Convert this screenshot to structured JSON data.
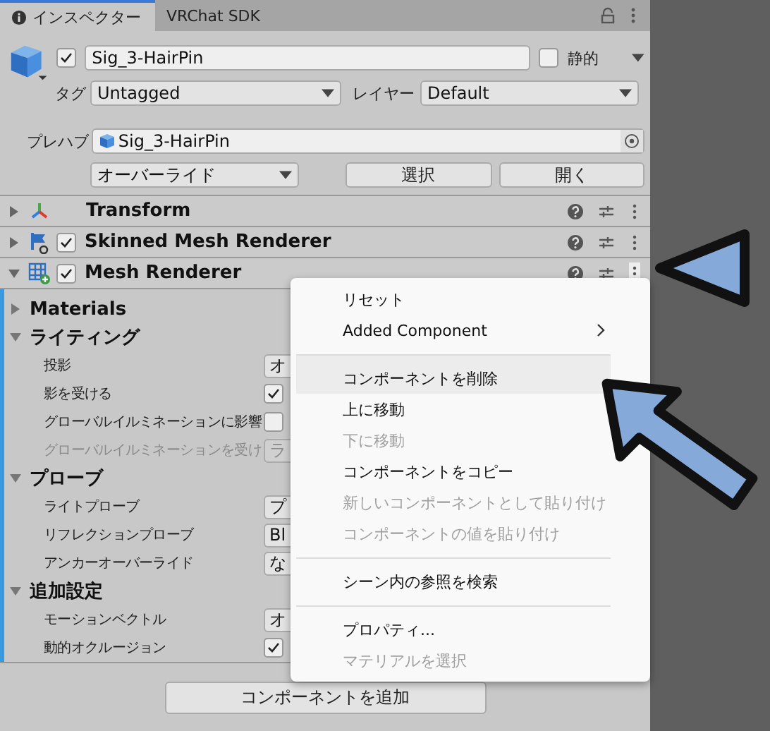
{
  "tabs": [
    {
      "label": "インスペクター",
      "selected": true
    },
    {
      "label": "VRChat SDK",
      "selected": false
    }
  ],
  "object": {
    "enabled": true,
    "name": "Sig_3-HairPin",
    "static": false,
    "static_label": "静的"
  },
  "tag": {
    "label": "タグ",
    "value": "Untagged"
  },
  "layer": {
    "label": "レイヤー",
    "value": "Default"
  },
  "prefab": {
    "label": "プレハブ",
    "value": "Sig_3-HairPin",
    "overrides": "オーバーライド",
    "buttons": [
      "選択",
      "開く"
    ]
  },
  "components": [
    {
      "kind": "transform",
      "name": "Transform",
      "selected": false
    },
    {
      "kind": "skinned",
      "name": "Skinned Mesh Renderer",
      "enabled": true,
      "selected": false
    },
    {
      "kind": "mesh",
      "name": "Mesh Renderer",
      "enabled": true,
      "selected": true
    }
  ],
  "sections": [
    {
      "title": "Materials",
      "expanded": false
    },
    {
      "title": "ライティング",
      "expanded": true,
      "properties": [
        {
          "kind": "dropdown",
          "label": "投影",
          "value": "オ",
          "disabled": false
        },
        {
          "kind": "checkbox",
          "label": "影を受ける",
          "checked": true,
          "disabled": false
        },
        {
          "kind": "checkbox",
          "label": "グローバルイルミネーションに影響",
          "checked": false,
          "disabled": false
        },
        {
          "kind": "dropdown",
          "label": "グローバルイルミネーションを受け",
          "value": "ラ",
          "disabled": true
        }
      ]
    },
    {
      "title": "プローブ",
      "expanded": true,
      "properties": [
        {
          "kind": "dropdown",
          "label": "ライトプローブ",
          "value": "プ",
          "disabled": false
        },
        {
          "kind": "dropdown",
          "label": "リフレクションプローブ",
          "value": "Bl",
          "disabled": false
        },
        {
          "kind": "dropdown",
          "label": "アンカーオーバーライド",
          "value": "な",
          "disabled": false
        }
      ]
    },
    {
      "title": "追加設定",
      "expanded": true,
      "properties": [
        {
          "kind": "dropdown",
          "label": "モーションベクトル",
          "value": "オ",
          "disabled": false
        },
        {
          "kind": "checkbox",
          "label": "動的オクルージョン",
          "checked": true,
          "disabled": false
        }
      ]
    }
  ],
  "add_button": "コンポーネントを追加",
  "menu": [
    {
      "label": "リセット",
      "disabled": false,
      "selected": false,
      "submenu": false,
      "separator_before": false
    },
    {
      "label": "Added Component",
      "disabled": false,
      "selected": false,
      "submenu": true,
      "separator_before": false
    },
    {
      "label": "コンポーネントを削除",
      "disabled": false,
      "selected": true,
      "submenu": false,
      "separator_before": true
    },
    {
      "label": "上に移動",
      "disabled": false,
      "selected": false,
      "submenu": false,
      "separator_before": false
    },
    {
      "label": "下に移動",
      "disabled": true,
      "selected": false,
      "submenu": false,
      "separator_before": false
    },
    {
      "label": "コンポーネントをコピー",
      "disabled": false,
      "selected": false,
      "submenu": false,
      "separator_before": false
    },
    {
      "label": "新しいコンポーネントとして貼り付け",
      "disabled": true,
      "selected": false,
      "submenu": false,
      "separator_before": false
    },
    {
      "label": "コンポーネントの値を貼り付け",
      "disabled": true,
      "selected": false,
      "submenu": false,
      "separator_before": false
    },
    {
      "label": "シーン内の参照を検索",
      "disabled": false,
      "selected": false,
      "submenu": false,
      "separator_before": true
    },
    {
      "label": "プロパティ...",
      "disabled": false,
      "selected": false,
      "submenu": false,
      "separator_before": true
    },
    {
      "label": "マテリアルを選択",
      "disabled": true,
      "selected": false,
      "submenu": false,
      "separator_before": false
    }
  ]
}
